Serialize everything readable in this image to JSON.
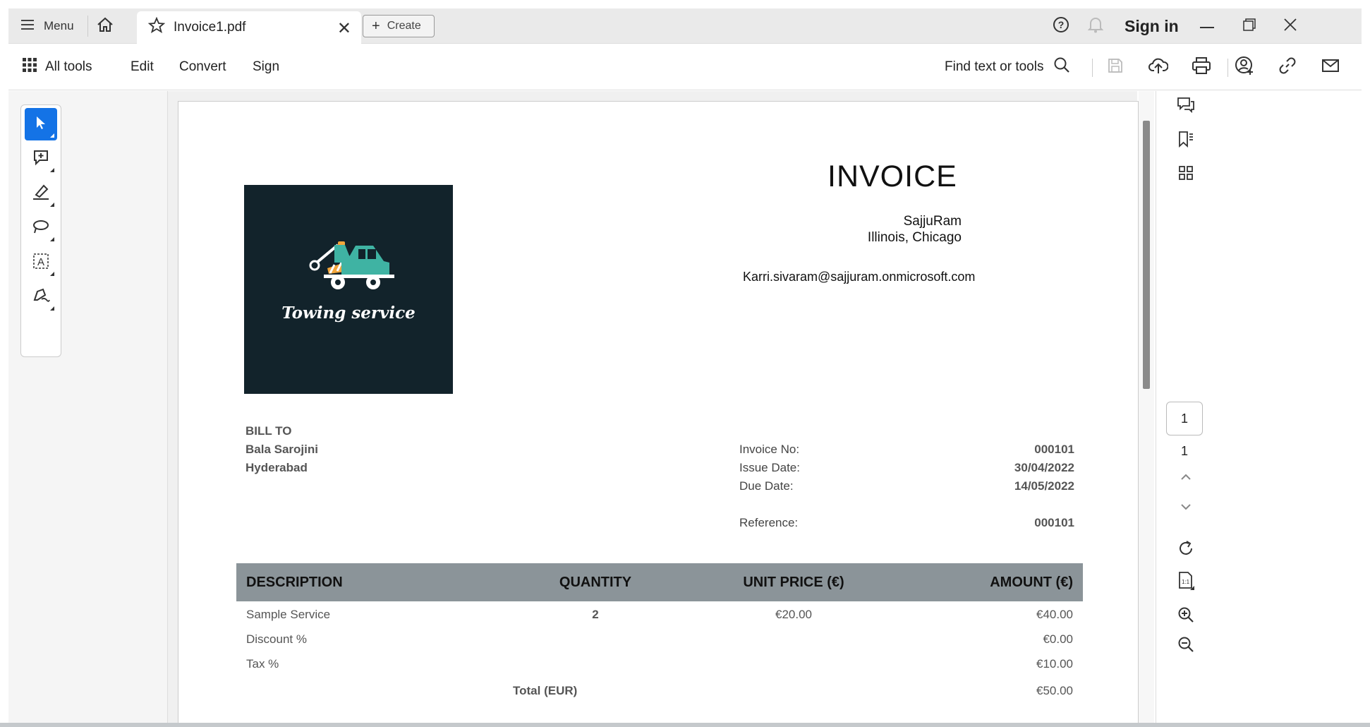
{
  "titlebar": {
    "menu_label": "Menu",
    "tab_title": "Invoice1.pdf",
    "create_label": "Create",
    "signin_label": "Sign in"
  },
  "toolbar": {
    "all_tools": "All tools",
    "edit": "Edit",
    "convert": "Convert",
    "sign": "Sign",
    "find": "Find text or tools"
  },
  "document": {
    "logo_text": "Towing service",
    "title": "INVOICE",
    "from_name": "SajjuRam",
    "from_location": "Illinois, Chicago",
    "email": "Karri.sivaram@sajjuram.onmicrosoft.com",
    "bill_to_label": "BILL TO",
    "bill_to_name": "Bala Sarojini",
    "bill_to_city": "Hyderabad",
    "meta": [
      {
        "label": "Invoice No:",
        "value": "000101"
      },
      {
        "label": "Issue Date:",
        "value": "30/04/2022"
      },
      {
        "label": "Due Date:",
        "value": "14/05/2022"
      },
      {
        "label": "Reference:",
        "value": "000101"
      }
    ],
    "table": {
      "headers": [
        "DESCRIPTION",
        "QUANTITY",
        "UNIT PRICE (€)",
        "AMOUNT (€)"
      ],
      "rows": [
        {
          "description": "Sample Service",
          "quantity": "2",
          "unit_price": "€20.00",
          "amount": "€40.00"
        },
        {
          "description": "Discount %",
          "quantity": "",
          "unit_price": "",
          "amount": "€0.00"
        },
        {
          "description": "Tax %",
          "quantity": "",
          "unit_price": "",
          "amount": "€10.00"
        }
      ],
      "total_label": "Total (EUR)",
      "total_value": "€50.00"
    }
  },
  "rightrail": {
    "current_page": "1",
    "page_count": "1"
  },
  "colors": {
    "accent": "#1473e6",
    "logo_bg": "#12232b",
    "table_header_bg": "#8b9499"
  }
}
